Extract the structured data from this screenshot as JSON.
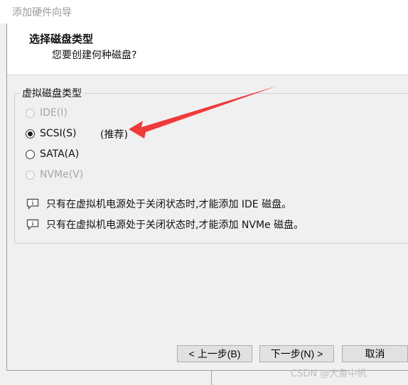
{
  "window": {
    "title": "添加硬件向导"
  },
  "header": {
    "title": "选择磁盘类型",
    "subtitle": "您要创建何种磁盘?"
  },
  "group": {
    "label": "虚拟磁盘类型",
    "options": [
      {
        "label": "IDE(I)",
        "checked": false,
        "disabled": true
      },
      {
        "label": "SCSI(S)",
        "checked": true,
        "disabled": false
      },
      {
        "label": "SATA(A)",
        "checked": false,
        "disabled": false
      },
      {
        "label": "NVMe(V)",
        "checked": false,
        "disabled": true
      }
    ],
    "recommend": "(推荐)",
    "notes": [
      {
        "icon": "info-icon",
        "text": "只有在虚拟机电源处于关闭状态时,才能添加 IDE 磁盘。"
      },
      {
        "icon": "info-icon",
        "text": "只有在虚拟机电源处于关闭状态时,才能添加 NVMe 磁盘。"
      }
    ]
  },
  "buttons": {
    "back": "< 上一步(B)",
    "next": "下一步(N) >",
    "cancel": "取消"
  },
  "watermark": "CSDN @大鱼中帆",
  "colors": {
    "annotation_arrow": "#f03a3a"
  }
}
